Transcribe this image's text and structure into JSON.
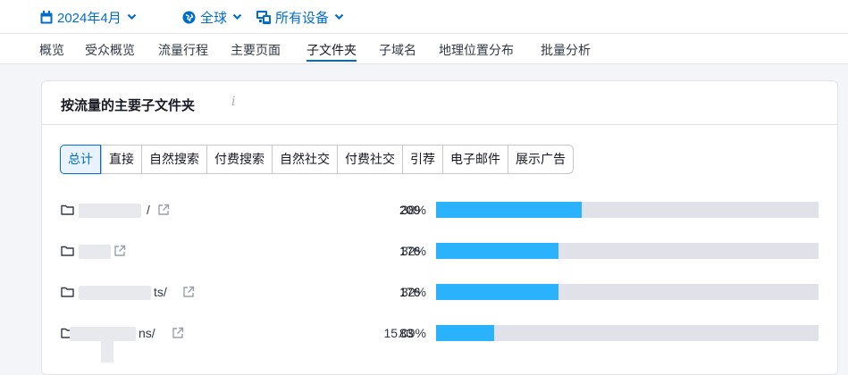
{
  "filters": {
    "date": "2024年4月",
    "region": "全球",
    "device": "所有设备"
  },
  "nav_tabs": [
    "概览",
    "受众概览",
    "流量行程",
    "主要页面",
    "子文件夹",
    "子域名",
    "地理位置分布",
    "批量分析"
  ],
  "active_nav": "子文件夹",
  "card": {
    "title": "按流量的主要子文件夹",
    "info_glyph": "i"
  },
  "segments": [
    "总计",
    "直接",
    "自然搜索",
    "付费搜索",
    "自然社交",
    "付费社交",
    "引荐",
    "电子邮件",
    "展示广告"
  ],
  "active_segment": "总计",
  "rows": [
    {
      "path_suffix": "/",
      "percent": "38%",
      "count": "209",
      "share": 0.38
    },
    {
      "path_suffix": "",
      "percent": "32%",
      "count": "176",
      "share": 0.32
    },
    {
      "path_suffix": "ts/",
      "percent": "32%",
      "count": "176",
      "share": 0.32
    },
    {
      "path_suffix": "ns/",
      "percent": "15.09%",
      "count": "83",
      "share": 0.1509
    }
  ],
  "colors": {
    "accent": "#006dca",
    "bar_fill": "#2bb2fc",
    "bar_track": "#e0e1e9"
  }
}
